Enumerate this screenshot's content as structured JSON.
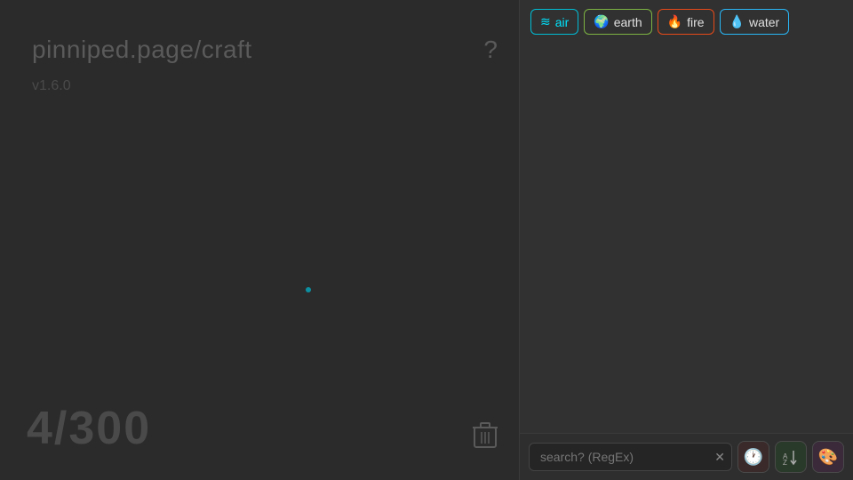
{
  "app": {
    "title": "pinniped.page/craft",
    "version": "v1.6.0",
    "help_label": "?"
  },
  "counter": {
    "current": "4",
    "max": "300",
    "display": "4/300"
  },
  "elements": [
    {
      "id": "air",
      "label": "air",
      "icon": "🌀",
      "class": "air"
    },
    {
      "id": "earth",
      "label": "earth",
      "icon": "🌍",
      "class": "earth"
    },
    {
      "id": "fire",
      "label": "fire",
      "icon": "🔥",
      "class": "fire"
    },
    {
      "id": "water",
      "label": "water",
      "icon": "💧",
      "class": "water"
    }
  ],
  "search": {
    "placeholder": "search? (RegEx)",
    "value": ""
  },
  "toolbar": {
    "clear_icon": "✕",
    "clock_icon": "🕐",
    "sort_icon": "🔤",
    "palette_icon": "🎨"
  }
}
